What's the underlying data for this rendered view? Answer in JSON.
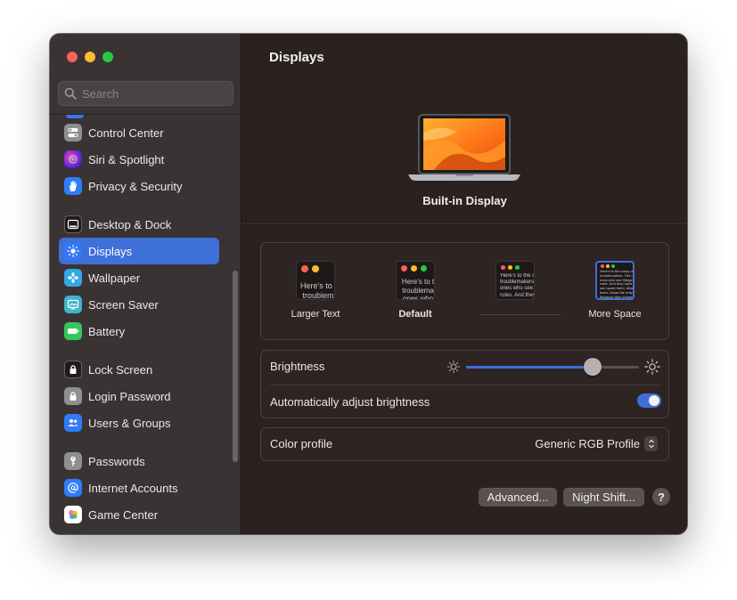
{
  "window": {
    "title": "Displays",
    "traffic_lights": [
      "close",
      "minimize",
      "zoom"
    ]
  },
  "sidebar": {
    "search_placeholder": "Search",
    "items": [
      {
        "label": "Control Center",
        "icon": "switches-icon",
        "color": "#8e8e93"
      },
      {
        "label": "Siri & Spotlight",
        "icon": "siri-icon",
        "color": "#9a3fd8"
      },
      {
        "label": "Privacy & Security",
        "icon": "hand-icon",
        "color": "#2f7cf6"
      },
      {
        "label": "Desktop & Dock",
        "icon": "dock-icon",
        "color": "#1c1c1e"
      },
      {
        "label": "Displays",
        "icon": "sun-icon",
        "color": "#3478f6",
        "active": true
      },
      {
        "label": "Wallpaper",
        "icon": "flower-icon",
        "color": "#31a7e6"
      },
      {
        "label": "Screen Saver",
        "icon": "screensaver-icon",
        "color": "#3fb5c8"
      },
      {
        "label": "Battery",
        "icon": "battery-icon",
        "color": "#34c759"
      },
      {
        "label": "Lock Screen",
        "icon": "lock-icon",
        "color": "#1c1c1e"
      },
      {
        "label": "Login Password",
        "icon": "padlock-icon",
        "color": "#8e8e93"
      },
      {
        "label": "Users & Groups",
        "icon": "users-icon",
        "color": "#2f7cf6"
      },
      {
        "label": "Passwords",
        "icon": "key-icon",
        "color": "#8e8e93"
      },
      {
        "label": "Internet Accounts",
        "icon": "at-icon",
        "color": "#2f7cf6"
      },
      {
        "label": "Game Center",
        "icon": "game-center-icon",
        "color": "#ffffff"
      }
    ]
  },
  "main": {
    "title": "Displays",
    "display_name": "Built-in Display",
    "resolution": {
      "options": [
        {
          "label": "Larger Text",
          "preview": "Here's to t\ntroublem",
          "selected": false
        },
        {
          "label": "Default",
          "preview": "Here's to t\ntroublema\nones who",
          "selected": false
        },
        {
          "label": "",
          "preview": "Here's to the c\ntroublemakers.\nones who see t\nrules. And they",
          "selected": false
        },
        {
          "label": "More Space",
          "preview": "Here's to the crazy ones\ntroublemakers. The round\nones who see things differ\nrules. And they have no\ncan quote them, disagree\nthem. About the only thin\nBecause they change th",
          "selected": true
        }
      ]
    },
    "brightness": {
      "label": "Brightness",
      "level": 0.73
    },
    "auto_brightness": {
      "label": "Automatically adjust brightness",
      "enabled": true
    },
    "color_profile": {
      "label": "Color profile",
      "value": "Generic RGB Profile"
    },
    "buttons": {
      "advanced": "Advanced...",
      "night_shift": "Night Shift...",
      "help": "?"
    }
  },
  "colors": {
    "accent": "#3f6fd8",
    "close": "#fe5f57",
    "minimize": "#febc2e",
    "zoom": "#28c840"
  }
}
